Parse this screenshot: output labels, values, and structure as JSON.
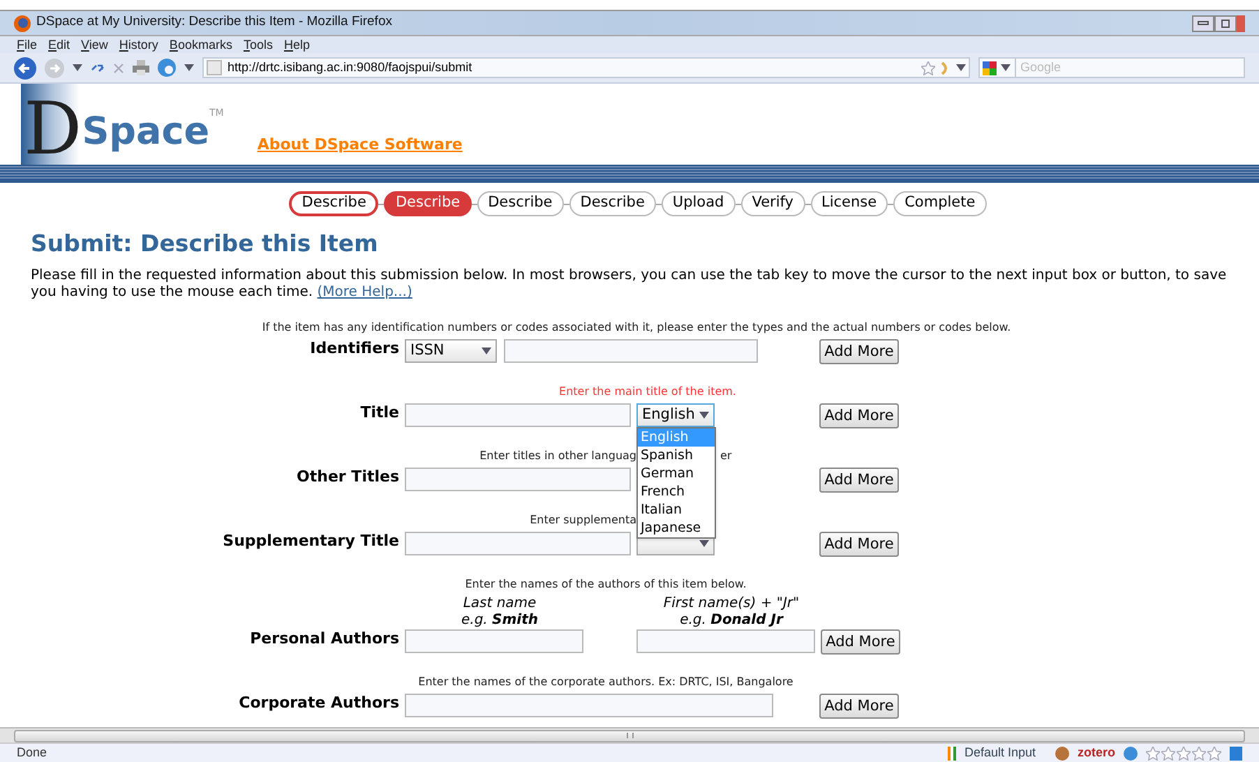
{
  "window": {
    "title": "DSpace at My University: Describe this Item - Mozilla Firefox"
  },
  "menu": [
    "File",
    "Edit",
    "View",
    "History",
    "Bookmarks",
    "Tools",
    "Help"
  ],
  "address": {
    "value": "http://drtc.isibang.ac.in:9080/faojspui/submit"
  },
  "search": {
    "placeholder": "Google"
  },
  "header": {
    "logo_initial": "D",
    "logo_word": "Space",
    "logo_mark": "TM",
    "link": "About DSpace Software"
  },
  "steps": [
    {
      "label": "Describe",
      "selected": false,
      "completed": true
    },
    {
      "label": "Describe",
      "selected": true,
      "completed": false
    },
    {
      "label": "Describe",
      "selected": false,
      "completed": false
    },
    {
      "label": "Describe",
      "selected": false,
      "completed": false
    },
    {
      "label": "Upload",
      "selected": false,
      "completed": false
    },
    {
      "label": "Verify",
      "selected": false,
      "completed": false
    },
    {
      "label": "License",
      "selected": false,
      "completed": false
    },
    {
      "label": "Complete",
      "selected": false,
      "completed": false
    }
  ],
  "heading": "Submit: Describe this Item",
  "intro": {
    "text": "Please fill in the requested information about this submission below. In most browsers, you can use the tab key to move the cursor to the next input box or button, to save you having to use the mouse each time.",
    "link": "(More Help...)"
  },
  "fields": [
    {
      "kind": "identifier",
      "hint": [
        "If the item has any identification numbers or codes associated with it, please enter the types and the actual numbers or codes below."
      ],
      "highlighted": false,
      "label": "Identifiers",
      "type": "ISSN",
      "button": "Add More"
    },
    {
      "kind": "titled",
      "hint": [
        "Enter the main title of the item."
      ],
      "highlighted": true,
      "label": "Title",
      "language": "English",
      "expanded": true,
      "options": [
        {
          "label": "English",
          "selected": true
        },
        {
          "label": "Spanish",
          "selected": false
        },
        {
          "label": "German",
          "selected": false
        },
        {
          "label": "French",
          "selected": false
        },
        {
          "label": "Italian",
          "selected": false
        },
        {
          "label": "Japanese",
          "selected": false
        }
      ],
      "button": "Add More"
    },
    {
      "kind": "titled",
      "hint": [
        "Enter titles in other languag",
        "er"
      ],
      "highlighted": false,
      "label": "Other Titles",
      "button": "Add More"
    },
    {
      "kind": "titled",
      "hint": [
        "Enter supplementa"
      ],
      "highlighted": false,
      "label": "Supplementary Title",
      "expanded": false,
      "button": "Add More"
    },
    {
      "kind": "name",
      "hint": [
        "Enter the names of the authors of this item below."
      ],
      "highlighted": false,
      "label": "Personal Authors",
      "last_label": "Last name",
      "last_example": "e.g. **Smith**",
      "first_label": "First name(s) + \"Jr\"",
      "first_example": "e.g. **Donald Jr**",
      "button": "Add More"
    },
    {
      "kind": "wide",
      "hint": [
        "Enter the names of the corporate authors. Ex: DRTC, ISI, Bangalore"
      ],
      "highlighted": false,
      "label": "Corporate Authors",
      "button": "Add More"
    }
  ],
  "status_bar": {
    "text": "Done",
    "input_method": "Default Input",
    "zotero": "zotero",
    "rating": {
      "stars": 0
    }
  }
}
